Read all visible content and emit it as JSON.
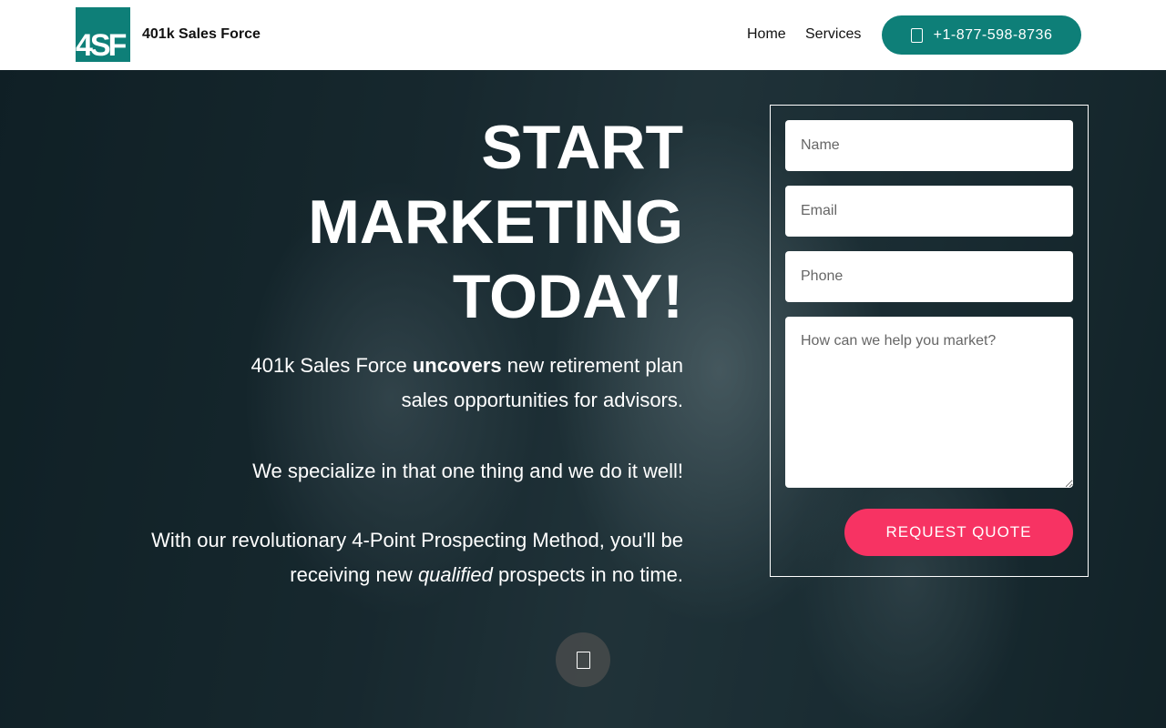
{
  "header": {
    "logo_text": "4SF",
    "brand_name": "401k Sales Force",
    "nav": [
      {
        "label": "Home"
      },
      {
        "label": "Services"
      }
    ],
    "phone_label": "+1-877-598-8736",
    "phone_icon": "phone-icon",
    "accent_color": "#0e7f78"
  },
  "hero": {
    "headline": [
      "START",
      "MARKETING",
      "TODAY!"
    ],
    "p1": {
      "before": "401k Sales Force ",
      "bold": "uncovers",
      "after_line1": " new retirement plan",
      "line2": "sales opportunities for advisors."
    },
    "p2": "We specialize in that one thing and we do it well!",
    "p3": {
      "line1": "With our revolutionary 4-Point Prospecting Method, you'll be",
      "before": "receiving new ",
      "italic": "qualified",
      "after": " prospects in no time."
    }
  },
  "form": {
    "name_placeholder": "Name",
    "email_placeholder": "Email",
    "phone_placeholder": "Phone",
    "message_placeholder": "How can we help you market?",
    "submit_label": "REQUEST QUOTE",
    "submit_color": "#f73363"
  },
  "scroll_icon": "chevron-down-icon"
}
